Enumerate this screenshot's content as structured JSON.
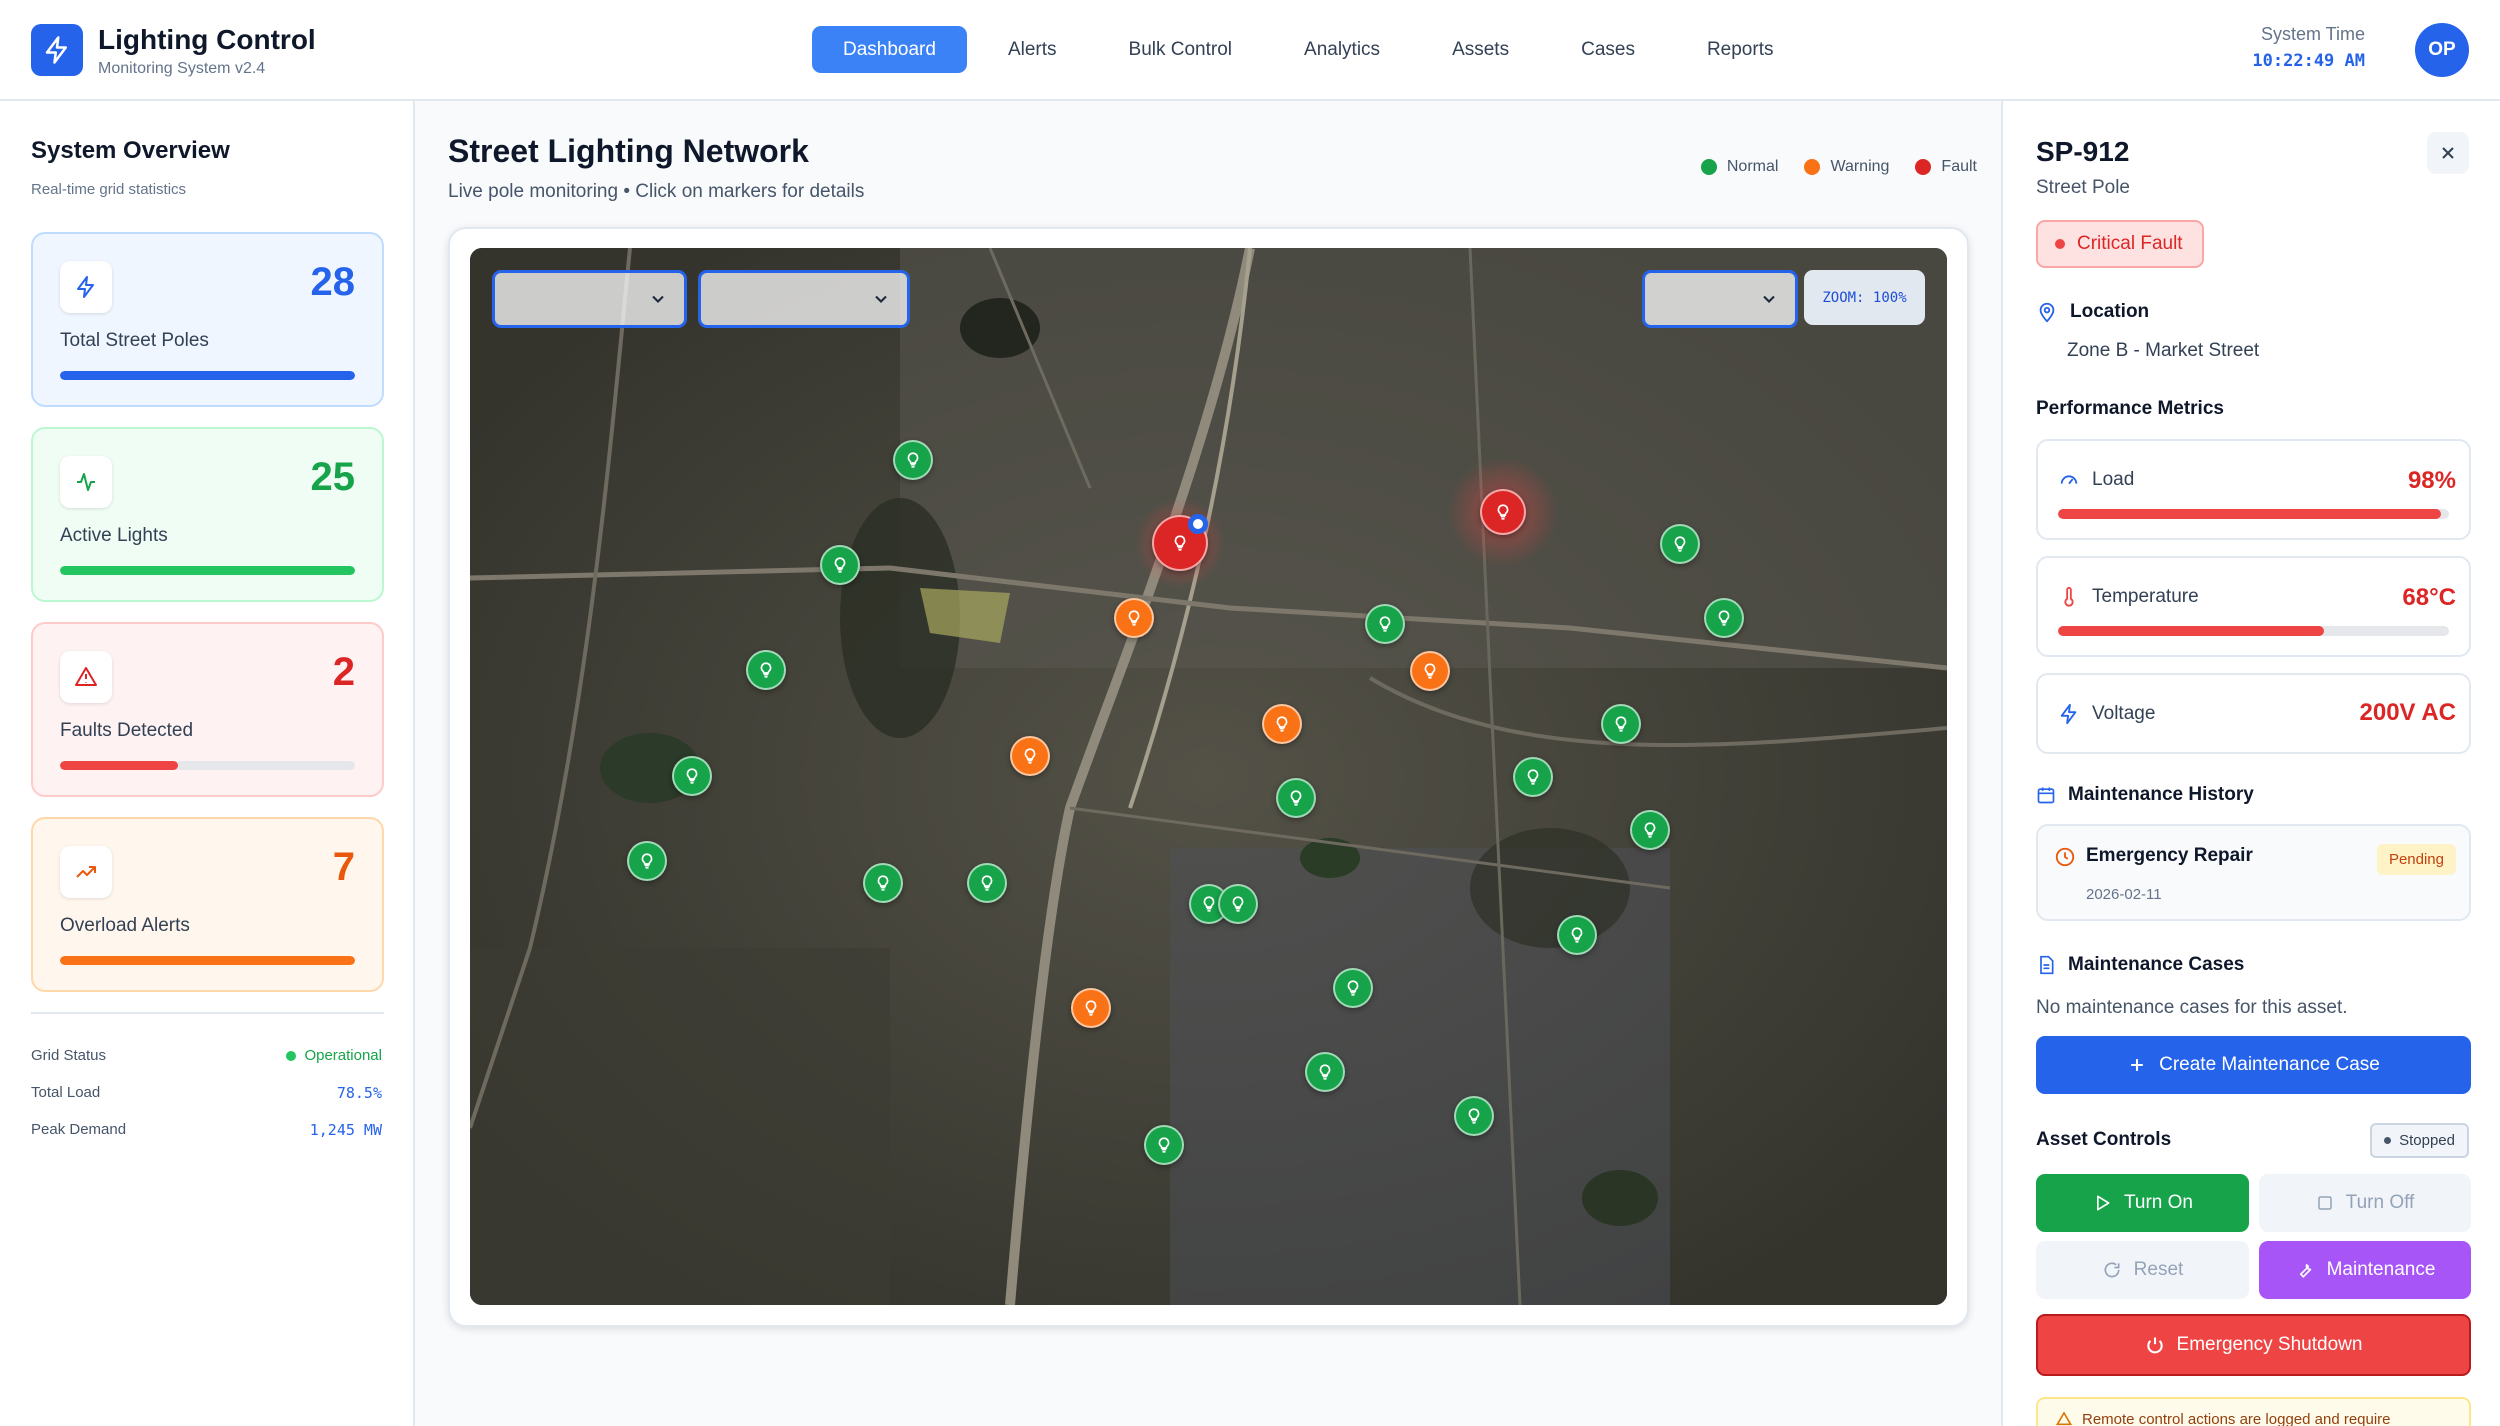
{
  "header": {
    "title": "Lighting Control",
    "subtitle": "Monitoring System v2.4",
    "nav": [
      "Dashboard",
      "Alerts",
      "Bulk Control",
      "Analytics",
      "Assets",
      "Cases",
      "Reports"
    ],
    "active_nav": "Dashboard",
    "system_time_label": "System Time",
    "system_time": "10:22:49 AM",
    "avatar": "OP"
  },
  "overview": {
    "title": "System Overview",
    "subtitle": "Real-time grid statistics",
    "cards": [
      {
        "value": "28",
        "label": "Total Street Poles",
        "icon": "bolt-icon",
        "color": "#2563eb",
        "fill_pct": 100
      },
      {
        "value": "25",
        "label": "Active Lights",
        "icon": "activity-icon",
        "color": "#16a34a",
        "fill_pct": 100
      },
      {
        "value": "2",
        "label": "Faults Detected",
        "icon": "warning-triangle-icon",
        "color": "#dc2626",
        "fill_pct": 40
      },
      {
        "value": "7",
        "label": "Overload Alerts",
        "icon": "trending-up-icon",
        "color": "#ea580c",
        "fill_pct": 100
      }
    ],
    "stats": {
      "grid_status_label": "Grid Status",
      "grid_status": "Operational",
      "total_load_label": "Total Load",
      "total_load": "78.5%",
      "peak_demand_label": "Peak Demand",
      "peak_demand": "1,245 MW"
    }
  },
  "map": {
    "title": "Street Lighting Network",
    "subtitle": "Live pole monitoring • Click on markers for details",
    "legend": [
      {
        "label": "Normal",
        "color": "#16a34a"
      },
      {
        "label": "Warning",
        "color": "#f97316"
      },
      {
        "label": "Fault",
        "color": "#dc2626"
      }
    ],
    "zoom": "ZOOM: 100%",
    "counts": {
      "normal": 23,
      "warning": 6,
      "fault": 2
    }
  },
  "detail": {
    "id": "SP-912",
    "type": "Street Pole",
    "status": "Critical Fault",
    "location_label": "Location",
    "location": "Zone B - Market Street",
    "metrics_title": "Performance Metrics",
    "metrics": [
      {
        "name": "Load",
        "value": "98%",
        "fill_pct": 98,
        "icon": "gauge-icon"
      },
      {
        "name": "Temperature",
        "value": "68°C",
        "fill_pct": 68,
        "icon": "thermometer-icon"
      },
      {
        "name": "Voltage",
        "value": "200V AC",
        "icon": "bolt-icon"
      }
    ],
    "history_title": "Maintenance History",
    "history": [
      {
        "title": "Emergency Repair",
        "date": "2026-02-11",
        "status": "Pending"
      }
    ],
    "cases_title": "Maintenance Cases",
    "cases_empty": "No maintenance cases for this asset.",
    "create_case": "Create Maintenance Case",
    "controls_title": "Asset Controls",
    "controls_state": "Stopped",
    "turn_on": "Turn On",
    "turn_off": "Turn Off",
    "reset": "Reset",
    "maintenance": "Maintenance",
    "emergency": "Emergency Shutdown",
    "notice": "Remote control actions are logged and require"
  }
}
